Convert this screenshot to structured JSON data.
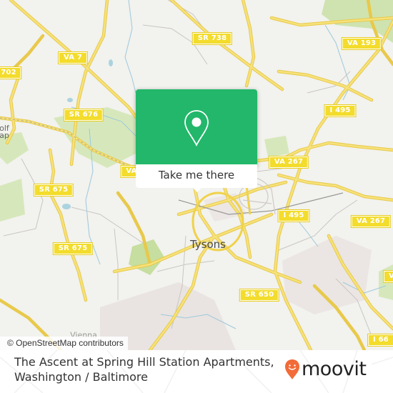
{
  "map": {
    "place_labels": [
      {
        "id": "tysons",
        "text": "Tysons",
        "kind": "city"
      },
      {
        "id": "vienna",
        "text": "Vienna",
        "kind": "small"
      },
      {
        "id": "wolf-trap",
        "text": "olf\nap",
        "kind": "small"
      }
    ],
    "road_shields": [
      {
        "id": "va-7",
        "text": "VA 7"
      },
      {
        "id": "sr-702",
        "text": "702"
      },
      {
        "id": "sr-738",
        "text": "SR 738"
      },
      {
        "id": "va-193",
        "text": "VA 193"
      },
      {
        "id": "sr-676",
        "text": "SR 676"
      },
      {
        "id": "i-495-north",
        "text": "I 495"
      },
      {
        "id": "va-267-west",
        "text": "VA 267"
      },
      {
        "id": "va-partial",
        "text": "VA"
      },
      {
        "id": "sr-675-north",
        "text": "SR 675"
      },
      {
        "id": "i-495-south",
        "text": "I 495"
      },
      {
        "id": "va-267-east",
        "text": "VA 267"
      },
      {
        "id": "sr-675-south",
        "text": "SR 675"
      },
      {
        "id": "sr-650",
        "text": "SR 650"
      },
      {
        "id": "i-66",
        "text": "I 66"
      },
      {
        "id": "v-partial",
        "text": "V"
      }
    ],
    "attribution": "© OpenStreetMap contributors",
    "colors": {
      "background": "#f2f2ee",
      "road": "#f3dc5a",
      "park": "#cfe3b0",
      "water": "#aad3df",
      "urban": "#e8e2de"
    }
  },
  "popup": {
    "icon": "map-pin-icon",
    "button_label": "Take me there",
    "color": "#22b76a"
  },
  "footer": {
    "title_line1": "The Ascent at Spring Hill Station Apartments,",
    "title_line2": "Washington / Baltimore",
    "brand": "moovit",
    "brand_color": "#f26b38"
  }
}
